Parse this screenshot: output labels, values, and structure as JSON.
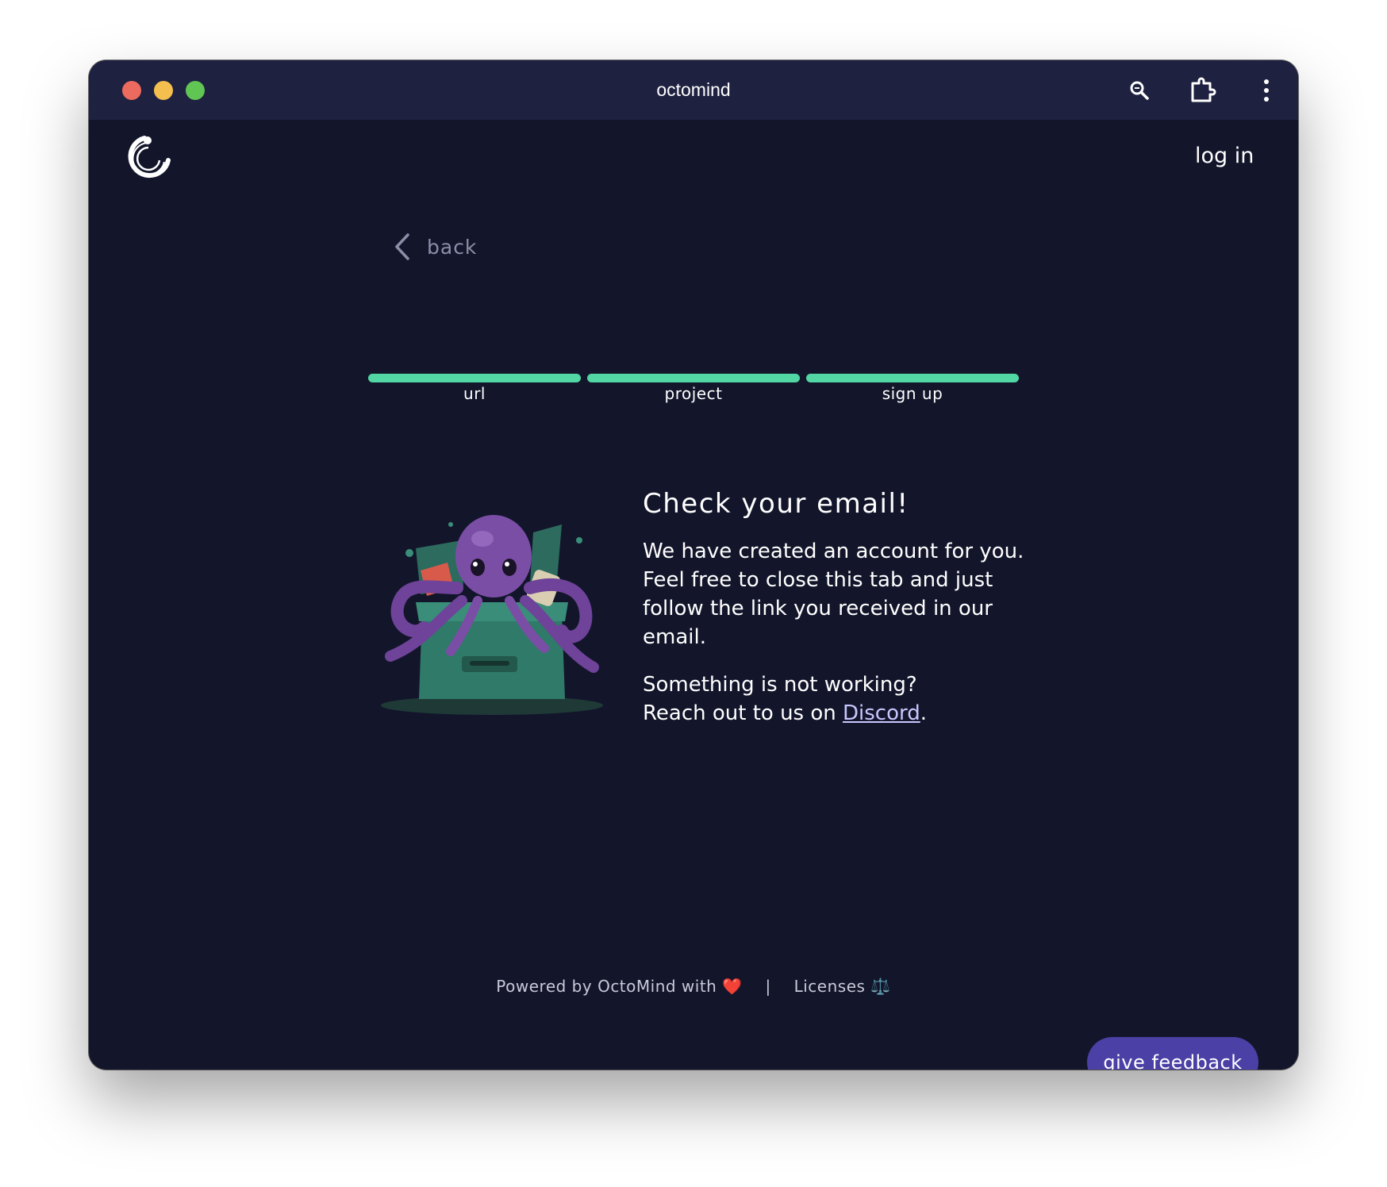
{
  "window": {
    "title": "octomind"
  },
  "toolbar": {
    "icons": [
      "search-icon",
      "extension-icon",
      "more-vertical-icon"
    ]
  },
  "header": {
    "login_label": "log in"
  },
  "nav": {
    "back_label": "back"
  },
  "steps": [
    {
      "label": "url",
      "complete": true
    },
    {
      "label": "project",
      "complete": true
    },
    {
      "label": "sign up",
      "complete": true
    }
  ],
  "message": {
    "title": "Check your email!",
    "body": "We have created an account for you. Feel free to close this tab and just follow the link you received in our email.",
    "help_line1": "Something is not working?",
    "help_prefix": "Reach out to us on ",
    "help_link": "Discord",
    "help_suffix": "."
  },
  "footer": {
    "powered_by": "Powered by OctoMind with",
    "heart": "❤️",
    "separator": "|",
    "licenses": "Licenses",
    "licenses_icon": "⚖️"
  },
  "feedback": {
    "label": "give feedback"
  },
  "colors": {
    "background": "#13162b",
    "titlebar": "#1e2140",
    "accent_green": "#52d6a4",
    "button_purple": "#4b40a6"
  }
}
